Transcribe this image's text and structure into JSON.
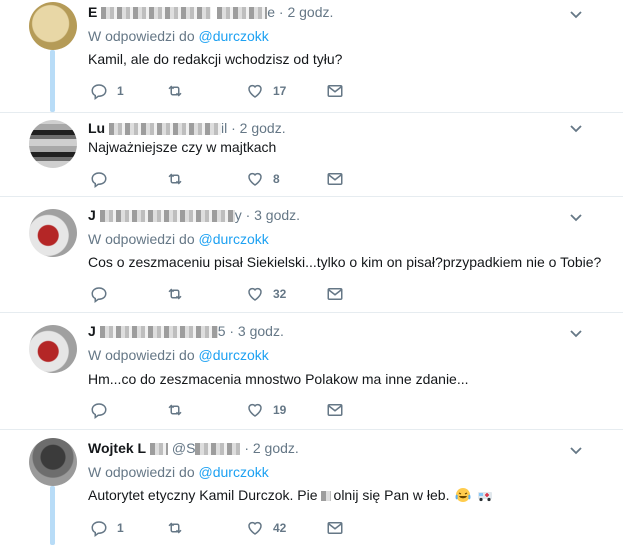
{
  "tweets": [
    {
      "name": "E",
      "handle": "e",
      "time": "· 2 godz.",
      "reply_label": "W odpowiedzi do",
      "reply_to": "@durczokk",
      "text": "Kamil, ale do redakcji wchodzisz od tyłu?",
      "replies": "1",
      "retweets": "",
      "likes": "17"
    },
    {
      "name": "Lu",
      "handle": "il",
      "time": "· 2 godz.",
      "reply_label": "",
      "reply_to": "",
      "text": "Najważniejsze czy w majtkach",
      "replies": "",
      "retweets": "",
      "likes": "8"
    },
    {
      "name": "J",
      "handle": "y",
      "time": "· 3 godz.",
      "reply_label": "W odpowiedzi do",
      "reply_to": "@durczokk",
      "text": "Cos o zeszmaceniu pisał Siekielski...tylko o kim on pisał?przypadkiem nie o Tobie?",
      "replies": "",
      "retweets": "",
      "likes": "32"
    },
    {
      "name": "J",
      "handle": "5",
      "time": "· 3 godz.",
      "reply_label": "W odpowiedzi do",
      "reply_to": "@durczokk",
      "text": "Hm...co do zeszmacenia mnostwo Polakow ma inne zdanie...",
      "replies": "",
      "retweets": "",
      "likes": "19"
    },
    {
      "name": "Wojtek L",
      "handle": "@S",
      "time": "· 2 godz.",
      "reply_label": "W odpowiedzi do",
      "reply_to": "@durczokk",
      "text_a": "Autorytet etyczny Kamil Durczok. Pie",
      "text_b": "olnij się Pan w łeb.",
      "replies": "1",
      "retweets": "",
      "likes": "42"
    }
  ],
  "icons": {
    "reply": "reply-icon",
    "retweet": "retweet-icon",
    "like": "heart-icon",
    "message": "envelope-icon",
    "menu": "chevron-down-icon"
  },
  "colors": {
    "accent": "#1da1f2",
    "muted": "#657786",
    "thread": "#b8dcf7",
    "divider": "#e6ecf0"
  }
}
